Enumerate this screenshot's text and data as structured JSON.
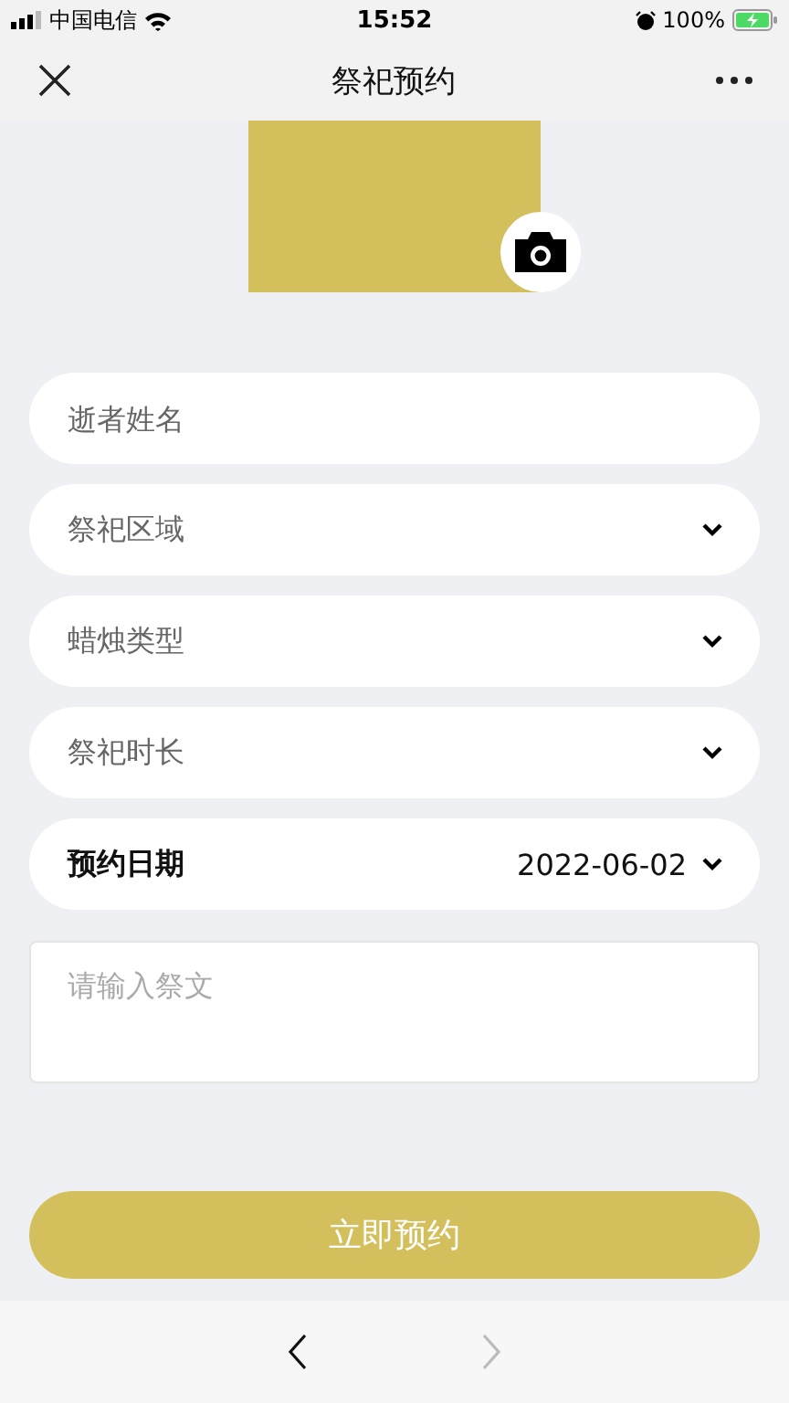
{
  "status_bar": {
    "carrier": "中国电信",
    "time": "15:52",
    "battery": "100%"
  },
  "nav_bar": {
    "title": "祭祀预约"
  },
  "fields": [
    {
      "kind": "text",
      "placeholder": "逝者姓名"
    },
    {
      "kind": "select",
      "placeholder": "祭祀区域"
    },
    {
      "kind": "select",
      "placeholder": "蜡烛类型"
    },
    {
      "kind": "select",
      "placeholder": "祭祀时长"
    },
    {
      "kind": "date",
      "label": "预约日期",
      "value": "2022-06-02"
    }
  ],
  "message": {
    "placeholder": "请输入祭文"
  },
  "submit_button": "立即预约",
  "browser_bar": {
    "back_disabled": false,
    "forward_disabled": true
  }
}
